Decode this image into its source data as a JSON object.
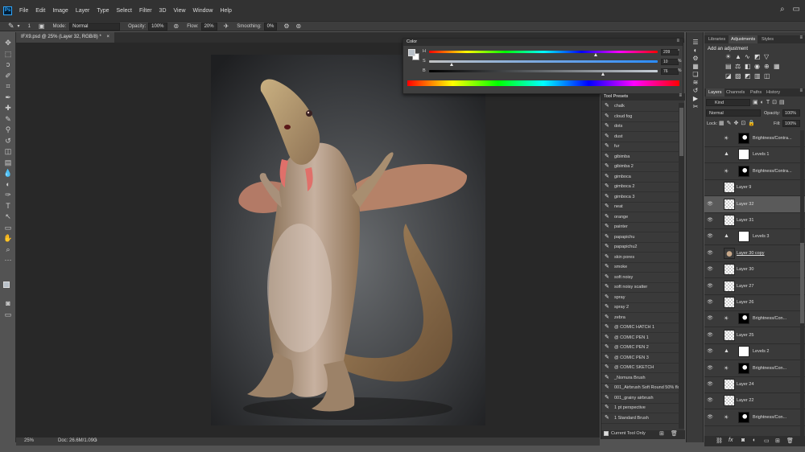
{
  "app": {
    "logo": "Ps"
  },
  "menu": [
    "File",
    "Edit",
    "Image",
    "Layer",
    "Type",
    "Select",
    "Filter",
    "3D",
    "View",
    "Window",
    "Help"
  ],
  "options": {
    "brush_size": "1",
    "mode_label": "Mode:",
    "mode_value": "Normal",
    "opacity_label": "Opacity:",
    "opacity_value": "100%",
    "flow_label": "Flow:",
    "flow_value": "20%",
    "smoothing_label": "Smoothing:",
    "smoothing_value": "0%"
  },
  "document": {
    "tab_title": "IFX9.psd @ 25% (Layer 32, RGB/8) *"
  },
  "status": {
    "zoom": "25%",
    "doc": "Doc: 26.6M/1.09G"
  },
  "color_panel": {
    "title": "Color",
    "sliders": [
      {
        "label": "H",
        "value": "209",
        "unit": "°",
        "pos": 0.73
      },
      {
        "label": "S",
        "value": "10",
        "unit": "%",
        "pos": 0.1
      },
      {
        "label": "B",
        "value": "76",
        "unit": "%",
        "pos": 0.76
      }
    ],
    "fg_color": "#b8c0c8",
    "bg_color": "#ffffff"
  },
  "presets": {
    "title": "Tool Presets",
    "items": [
      "chalk",
      "cloud fog",
      "dots",
      "dust",
      "fur",
      "gibimba",
      "gibimba 2",
      "gimboca",
      "gimboca 2",
      "gimboca 3",
      "neat",
      "orange",
      "painter",
      "papapichu",
      "papapichu2",
      "skin pores",
      "smoke",
      "soft noisy",
      "soft noisy scatter",
      "spray",
      "spray 2",
      "zebra",
      "@ COMIC HATCH 1",
      "@ COMIC PEN 1",
      "@ COMIC PEN 2",
      "@ COMIC PEN 3",
      "@ COMIC SKETCH",
      "_Nomura Brush",
      "001_Airbrush Soft Round 50% flow",
      "001_grainy airbrush",
      "1 pt perspective",
      "1 Standard Brush"
    ],
    "current_tool_only": "Current Tool Only"
  },
  "adjustments": {
    "tabs": [
      "Libraries",
      "Adjustments",
      "Styles"
    ],
    "title": "Add an adjustment"
  },
  "layers": {
    "tabs": [
      "Layers",
      "Channels",
      "Paths",
      "History"
    ],
    "kind": "Kind",
    "blend": "Normal",
    "opacity_label": "Opacity:",
    "opacity_value": "100%",
    "lock_label": "Lock:",
    "fill_label": "Fill:",
    "fill_value": "100%",
    "items": [
      {
        "name": "Brightness/Contra...",
        "type": "adj"
      },
      {
        "name": "Levels 1",
        "type": "levels"
      },
      {
        "name": "Brightness/Contra...",
        "type": "adj"
      },
      {
        "name": "Layer 9",
        "type": "layer"
      },
      {
        "name": "Layer 32",
        "type": "layer"
      },
      {
        "name": "Layer 31",
        "type": "layer"
      },
      {
        "name": "Levels 3",
        "type": "levels"
      },
      {
        "name": "Layer 30 copy",
        "type": "photo"
      },
      {
        "name": "Layer 30",
        "type": "layer"
      },
      {
        "name": "Layer 27",
        "type": "layer"
      },
      {
        "name": "Layer 26",
        "type": "layer"
      },
      {
        "name": "Brightness/Con...",
        "type": "adj"
      },
      {
        "name": "Layer 25",
        "type": "layer"
      },
      {
        "name": "Levels 2",
        "type": "levels"
      },
      {
        "name": "Brightness/Con...",
        "type": "adj"
      },
      {
        "name": "Layer 24",
        "type": "layer"
      },
      {
        "name": "Layer 22",
        "type": "layer"
      },
      {
        "name": "Brightness/Con...",
        "type": "adj"
      }
    ]
  }
}
